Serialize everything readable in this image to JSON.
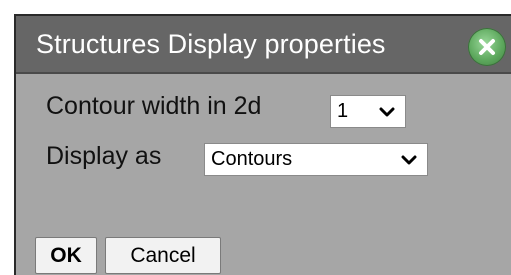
{
  "dialog": {
    "title": "Structures Display properties",
    "close_icon": "close-circle-icon"
  },
  "form": {
    "contour_width_label": "Contour width in 2d",
    "contour_width_value": "1",
    "display_as_label": "Display as",
    "display_as_value": "Contours"
  },
  "buttons": {
    "ok_label": "OK",
    "cancel_label": "Cancel"
  },
  "colors": {
    "titlebar_bg": "#666666",
    "dialog_bg": "#a6a6a6",
    "close_button": "#5da85d"
  }
}
